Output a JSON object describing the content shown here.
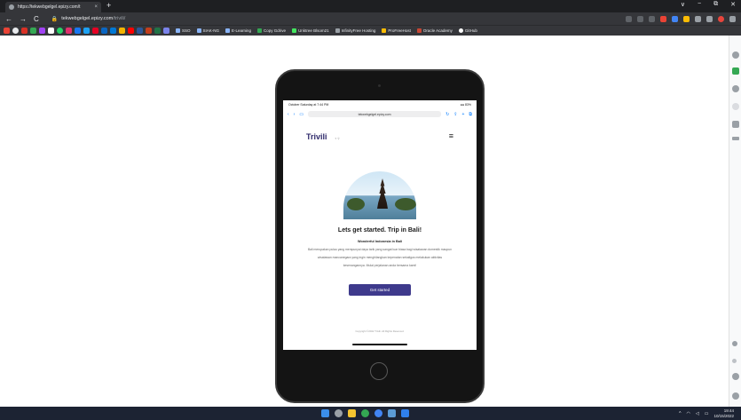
{
  "browser": {
    "tab_title": "https://tekwebgelgel.epizy.com/t",
    "url_host": "tekwebgelgel.epizy.com",
    "url_path": "/trivili/",
    "window_controls": [
      "∨",
      "−",
      "⧉",
      "✕"
    ],
    "bookmarks": [
      "SSO",
      "SIAK-NG",
      "E-Learning",
      "Copy Gdrive",
      "Unktree Blsom21",
      "InfinityFree Hosting",
      "ProFreeHost",
      "Oracle Academy",
      "GitHub"
    ]
  },
  "ipad": {
    "status_left": "October Saturday at 7:44 PM",
    "status_right": "●● 83%",
    "address": "tekwebgelgel.epizy.com",
    "brand": "Trivili",
    "headline": "Lets get started. Trip in Bali!",
    "subheading": "Wonderful Indonesia in Bali",
    "paragraph": "Bali merupakan pulau yang mempunyai daya tarik yang sangat luar biasa bagi wisatawan domestik maupun wisatawan mancanegara yang ingin menghilangkan kepenatan sekaligus melakukan aktivitas kesenangannya. Mulai perjalanan anda bersama kami!",
    "cta": "Get started",
    "footer": "Copyright ©2022 Trivili. All Rights Reserved."
  },
  "taskbar": {
    "time": "19:44",
    "date": "10/15/2022"
  },
  "colors": {
    "brand": "#2f2a6b",
    "cta": "#3e3a8c",
    "chrome_dark": "#35363a"
  }
}
